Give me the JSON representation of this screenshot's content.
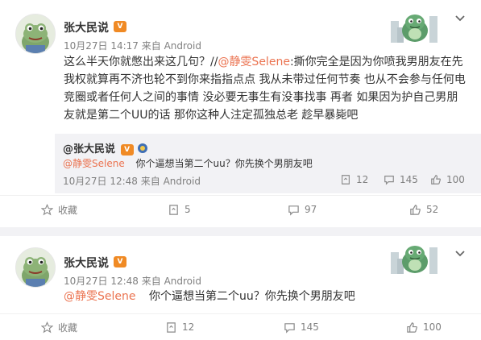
{
  "posts": [
    {
      "username": "张大民说",
      "badge": "V",
      "timestamp": "10月27日 14:17",
      "source": "来自 Android",
      "content": {
        "lines": [
          {
            "pre": "这么半天你就憋出来这几句？//",
            "mention": "@静雯Selene",
            "post": ":撕你完全是因为你喷我男朋友在先"
          },
          {
            "text": "我权就算再不济也轮不到你来指指点点 我从未带过任何节奏 也从不会参与任何电"
          },
          {
            "text": "竞圈或者任何人之间的事情 没必要无事生有没事找事 再者 如果因为护自己男朋"
          },
          {
            "text": "友就是第二个UU的话 那你这种人注定孤独总老 趁早暴毙吧"
          }
        ]
      },
      "quoted": {
        "author": "@张大民说",
        "mention": "@静雯Selene",
        "text": "你个逼想当第二个uu？你先换个男朋友吧",
        "timestamp": "10月27日 12:48",
        "source": "来自 Android",
        "reposts": "12",
        "comments": "145",
        "likes": "100"
      },
      "actions": {
        "favorite_label": "收藏",
        "reposts": "5",
        "comments": "97",
        "likes": "52"
      }
    },
    {
      "username": "张大民说",
      "badge": "V",
      "timestamp": "10月27日 12:48",
      "source": "来自 Android",
      "content": {
        "mention": "@静雯Selene",
        "text": "你个逼想当第二个uu？你先换个男朋友吧"
      },
      "actions": {
        "favorite_label": "收藏",
        "reposts": "12",
        "comments": "145",
        "likes": "100"
      }
    }
  ],
  "colors": {
    "mention": "#eb7350",
    "meta": "#808080",
    "quote_bg": "#f2f2f5",
    "badge": "#f08a24"
  },
  "icons": {
    "avatar": "frog-avatar",
    "badge": "vip-badge-icon",
    "sticker": "dinosaur-sticker",
    "menu": "chevron-down-icon",
    "favorite": "star-icon",
    "repost": "repost-icon",
    "comment": "comment-icon",
    "like": "thumbs-up-icon"
  }
}
